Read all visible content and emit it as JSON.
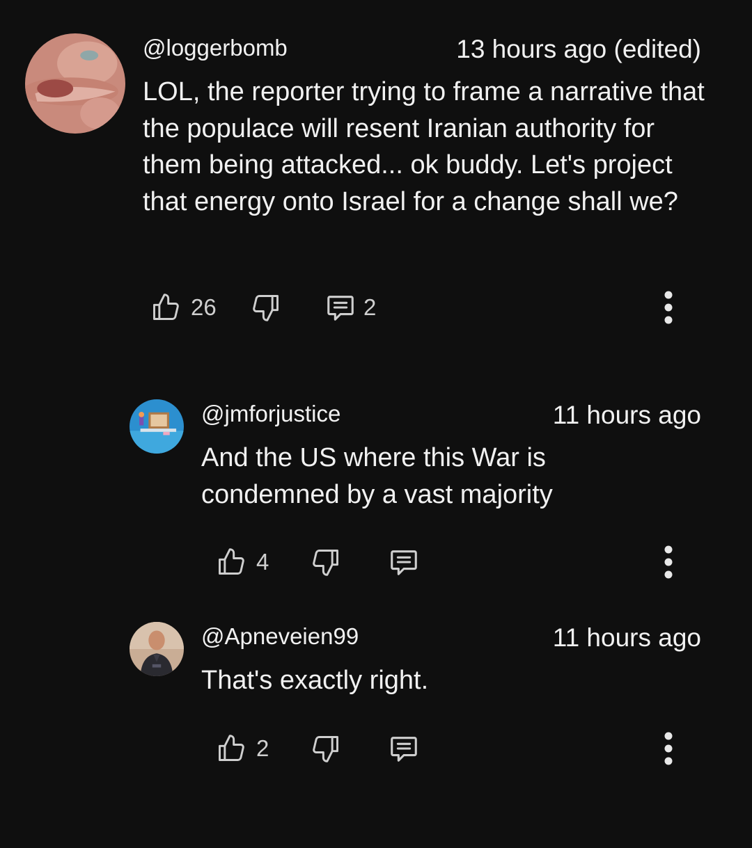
{
  "comments": [
    {
      "handle": "@loggerbomb",
      "time": "13 hours ago (edited)",
      "text": "LOL, the reporter trying to frame a narrative that the populace will resent Iranian authority for them being attacked... ok buddy. Let's project that energy onto Israel for a change shall we?",
      "likes": "26",
      "replies": "2"
    },
    {
      "handle": "@jmforjustice",
      "time": "11 hours ago",
      "text": "And the US where this War is condemned by a vast majority",
      "likes": "4"
    },
    {
      "handle": "@Apneveien99",
      "time": "11 hours ago",
      "text": "That's exactly right.",
      "likes": "2"
    }
  ],
  "icons": {
    "like": "thumbs-up-icon",
    "dislike": "thumbs-down-icon",
    "reply": "comment-icon",
    "more": "more-vertical-icon"
  },
  "colors": {
    "background": "#0f0f0f",
    "text": "#f1f1f1",
    "icon": "#cfcfcf"
  }
}
